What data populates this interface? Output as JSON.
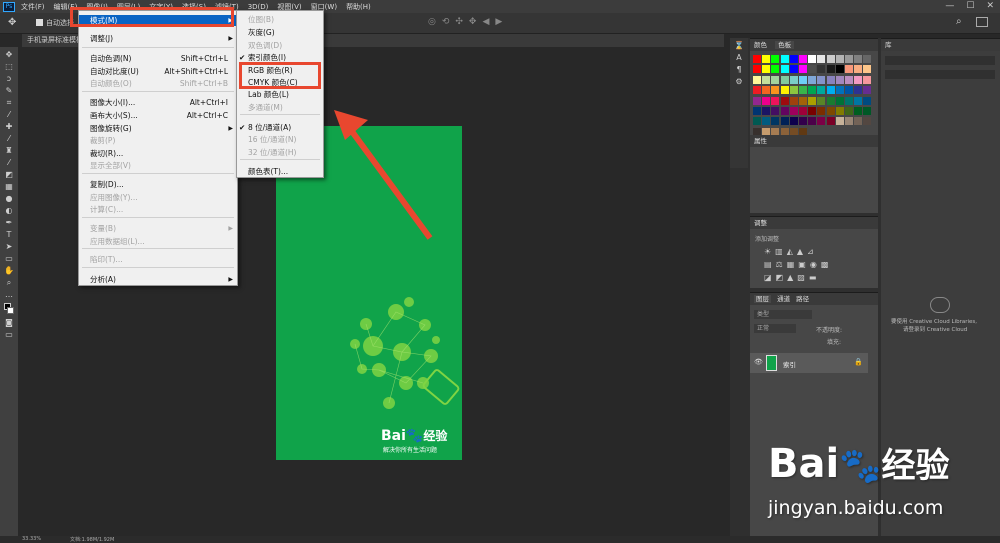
{
  "menubar": {
    "items": [
      "文件(F)",
      "编辑(E)",
      "图像(I)",
      "图层(L)",
      "文字(Y)",
      "选择(S)",
      "滤镜(T)",
      "3D(D)",
      "视图(V)",
      "窗口(W)",
      "帮助(H)"
    ]
  },
  "options": {
    "auto_select_label": "自动选择"
  },
  "document_tab": {
    "title": "手机录屏标准模板"
  },
  "image_menu": {
    "items": [
      {
        "label": "模式(M)",
        "shortcut": "",
        "submenu": true,
        "disabled": false,
        "highlighted": true
      },
      {
        "label": "调整(J)",
        "shortcut": "",
        "submenu": true,
        "disabled": false
      },
      {
        "label": "自动色调(N)",
        "shortcut": "Shift+Ctrl+L",
        "disabled": false
      },
      {
        "label": "自动对比度(U)",
        "shortcut": "Alt+Shift+Ctrl+L",
        "disabled": false
      },
      {
        "label": "自动颜色(O)",
        "shortcut": "Shift+Ctrl+B",
        "disabled": true
      },
      {
        "label": "图像大小(I)...",
        "shortcut": "Alt+Ctrl+I",
        "disabled": false
      },
      {
        "label": "画布大小(S)...",
        "shortcut": "Alt+Ctrl+C",
        "disabled": false
      },
      {
        "label": "图像旋转(G)",
        "shortcut": "",
        "submenu": true,
        "disabled": false
      },
      {
        "label": "裁剪(P)",
        "shortcut": "",
        "disabled": true
      },
      {
        "label": "裁切(R)...",
        "shortcut": "",
        "disabled": false
      },
      {
        "label": "显示全部(V)",
        "shortcut": "",
        "disabled": true
      },
      {
        "label": "复制(D)...",
        "shortcut": "",
        "disabled": false
      },
      {
        "label": "应用图像(Y)...",
        "shortcut": "",
        "disabled": true
      },
      {
        "label": "计算(C)...",
        "shortcut": "",
        "disabled": true
      },
      {
        "label": "变量(B)",
        "shortcut": "",
        "submenu": true,
        "disabled": true
      },
      {
        "label": "应用数据组(L)...",
        "shortcut": "",
        "disabled": true
      },
      {
        "label": "陷印(T)...",
        "shortcut": "",
        "disabled": true
      },
      {
        "label": "分析(A)",
        "shortcut": "",
        "submenu": true,
        "disabled": false
      }
    ]
  },
  "mode_menu": {
    "items": [
      {
        "label": "位图(B)",
        "disabled": true,
        "checked": false
      },
      {
        "label": "灰度(G)",
        "disabled": false,
        "checked": false
      },
      {
        "label": "双色调(D)",
        "disabled": true,
        "checked": false
      },
      {
        "label": "索引颜色(I)",
        "disabled": false,
        "checked": true
      },
      {
        "label": "RGB 颜色(R)",
        "disabled": false,
        "checked": false
      },
      {
        "label": "CMYK 颜色(C)",
        "disabled": false,
        "checked": false
      },
      {
        "label": "Lab 颜色(L)",
        "disabled": false,
        "checked": false
      },
      {
        "label": "多通道(M)",
        "disabled": true,
        "checked": false
      },
      {
        "label": "8 位/通道(A)",
        "disabled": false,
        "checked": true
      },
      {
        "label": "16 位/通道(N)",
        "disabled": true,
        "checked": false
      },
      {
        "label": "32 位/通道(H)",
        "disabled": true,
        "checked": false
      },
      {
        "label": "颜色表(T)...",
        "disabled": false,
        "checked": false
      }
    ]
  },
  "panels": {
    "color_tabs": [
      "颜色",
      "色板"
    ],
    "properties_tab": "属性",
    "library_tab": "库",
    "adjustments_tab": "调整",
    "adjustments_add": "添加调整",
    "layers_tabs": [
      "图层",
      "通道",
      "路径"
    ],
    "layers_kind": "类型",
    "blend_mode": "正常",
    "opacity_label": "不透明度:",
    "fill_label": "填充:",
    "layer_name": "索引",
    "cc_message_1": "要使用 Creative Cloud Libraries,",
    "cc_message_2": "请登录到 Creative Cloud"
  },
  "doc_content": {
    "brand": "Bai",
    "brand2": "经验",
    "slogan": "解决你所有生活问题"
  },
  "status": {
    "zoom": "33.33%",
    "doc": "文档:1.98M/1.92M"
  },
  "watermark": {
    "brand": "Bai",
    "brand2": "经验",
    "url": "jingyan.baidu.com"
  },
  "colors": {
    "accent": "#0a64c4",
    "red_box": "#e8472f",
    "doc_green": "#10a34a"
  }
}
